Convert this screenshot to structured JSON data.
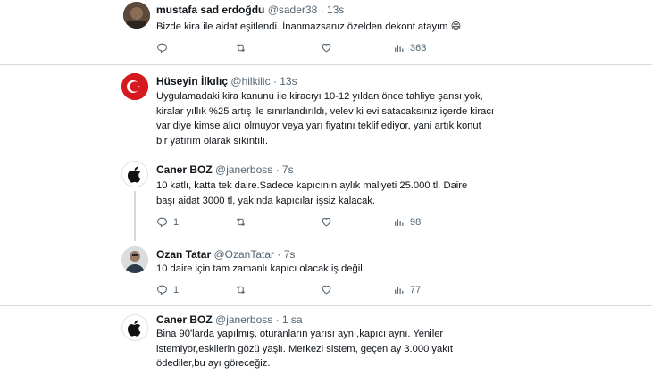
{
  "tweets": [
    {
      "name": "mustafa sad erdoğdu",
      "handle": "@sader38",
      "time": "· 13s",
      "text": "Bizde kira ile aidat eşitlendi. İnanmazsanız özelden dekont atayım 😄",
      "stats": {
        "replies": "",
        "retweets": "",
        "likes": "",
        "views": "363"
      }
    },
    {
      "name": "Hüseyin İlkılıç",
      "handle": "@hilkilic",
      "time": "· 13s",
      "text": "Uygulamadaki kira kanunu ile kiracıyı 10-12 yıldan önce tahliye şansı yok,\nkiralar yıllık %25 artış ile sınırlandırıldı, velev ki evi satacaksınız içerde kiracı\nvar diye kimse alıcı olmuyor veya yarı fiyatını teklif ediyor, yani  artık konut\nbir yatırım olarak sıkıntılı."
    },
    {
      "name": "Caner BOZ",
      "handle": "@janerboss",
      "time": "· 7s",
      "text": "10 katlı, katta tek daire.Sadece kapıcının aylık maliyeti 25.000 tl. Daire\nbaşı aidat 3000 tl, yakında kapıcılar işsiz kalacak.",
      "stats": {
        "replies": "1",
        "retweets": "",
        "likes": "",
        "views": "98"
      }
    },
    {
      "name": "Ozan Tatar",
      "handle": "@OzanTatar",
      "time": "· 7s",
      "text": "10 daire için tam zamanlı kapıcı olacak iş değil.",
      "stats": {
        "replies": "1",
        "retweets": "",
        "likes": "",
        "views": "77"
      }
    },
    {
      "name": "Caner BOZ",
      "handle": "@janerboss",
      "time": "· 1 sa",
      "text": "Bina 90'larda yapılmış, oturanların yarısı aynı,kapıcı aynı. Yeniler\nistemiyor,eskilerin gözü yaşlı. Merkezi sistem, geçen ay 3.000 yakıt\nödediler,bu ayı göreceğiz."
    }
  ]
}
